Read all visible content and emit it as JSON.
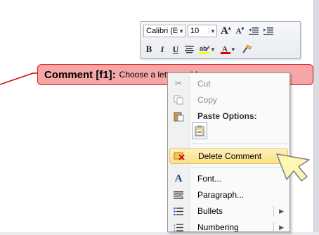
{
  "minitoolbar": {
    "font_name": "Calibri (E",
    "font_size": "10",
    "bold": "B",
    "italic": "I",
    "underline": "U"
  },
  "balloon": {
    "label": "Comment [f1]:",
    "text": "Choose a letter and I"
  },
  "menu": {
    "cut": "Cut",
    "copy": "Copy",
    "paste_options": "Paste Options:",
    "delete_comment": "Delete Comment",
    "font": "Font...",
    "paragraph": "Paragraph...",
    "bullets": "Bullets",
    "numbering": "Numbering"
  },
  "colors": {
    "balloon_fill": "#f5a7a7",
    "balloon_border": "#e01b1b",
    "connector": "#cc0000",
    "selected_item": "#fbe08a"
  }
}
